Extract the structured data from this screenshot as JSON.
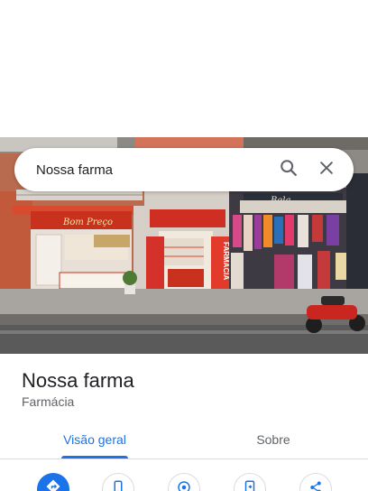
{
  "search": {
    "query": "Nossa farma",
    "search_icon": "search-icon",
    "clear_icon": "close-icon"
  },
  "photo": {
    "sign_store_left": "Bom Preço",
    "banner_vertical": "FARMÁCIA",
    "sign_store_right": "Bela"
  },
  "place": {
    "name": "Nossa farma",
    "category": "Farmácia"
  },
  "tabs": [
    {
      "label": "Visão geral",
      "selected": true
    },
    {
      "label": "Sobre",
      "selected": false
    }
  ],
  "action_icons": [
    "directions-icon",
    "call-icon",
    "nearby-icon",
    "save-to-phone-icon",
    "share-icon"
  ],
  "colors": {
    "accent": "#1a73e8",
    "text_primary": "#202124",
    "text_secondary": "#5f6368"
  }
}
